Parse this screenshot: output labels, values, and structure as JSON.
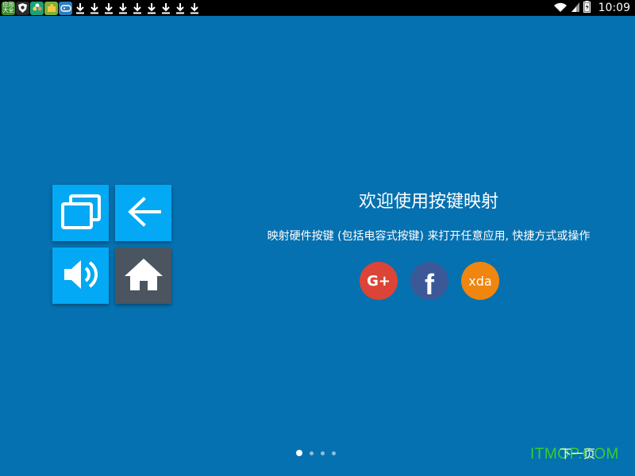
{
  "status_bar": {
    "time": "10:09",
    "notification_apps": [
      {
        "icon": "app-grid-icon",
        "text": "应用\n大全",
        "color": "#3d8c2f"
      },
      {
        "icon": "shield-icon",
        "text": "",
        "color": "#2b2b2b"
      },
      {
        "icon": "flower-icon",
        "text": "",
        "color": "#1aa37a"
      },
      {
        "icon": "puzzle-icon",
        "text": "",
        "color": "#7bb33a"
      },
      {
        "icon": "gamepad-icon",
        "text": "",
        "color": "#2a7fc0"
      }
    ],
    "download_count": 9,
    "icons": [
      "wifi-icon",
      "signal-icon",
      "battery-icon"
    ]
  },
  "tiles": [
    {
      "icon": "recent-apps-icon",
      "color": "#03a9f4"
    },
    {
      "icon": "back-arrow-icon",
      "color": "#03a9f4"
    },
    {
      "icon": "volume-icon",
      "color": "#03a9f4"
    },
    {
      "icon": "home-icon",
      "color": "#4a5560"
    }
  ],
  "welcome": {
    "title": "欢迎使用按键映射",
    "description": "映射硬件按键 (包括电容式按键) 来打开任意应用, 快捷方式或操作"
  },
  "social": {
    "google_plus_label": "G+",
    "facebook_label": "f",
    "xda_label": "xda",
    "colors": {
      "google_plus": "#db4437",
      "facebook": "#3b5998",
      "xda": "#f0860f"
    }
  },
  "pager": {
    "current_page": 1,
    "total_pages": 4
  },
  "next_label": "下一页",
  "watermark": "ITMOP.COM",
  "colors": {
    "background": "#0671b0",
    "tile": "#03a9f4",
    "tile_home": "#4a5560"
  }
}
